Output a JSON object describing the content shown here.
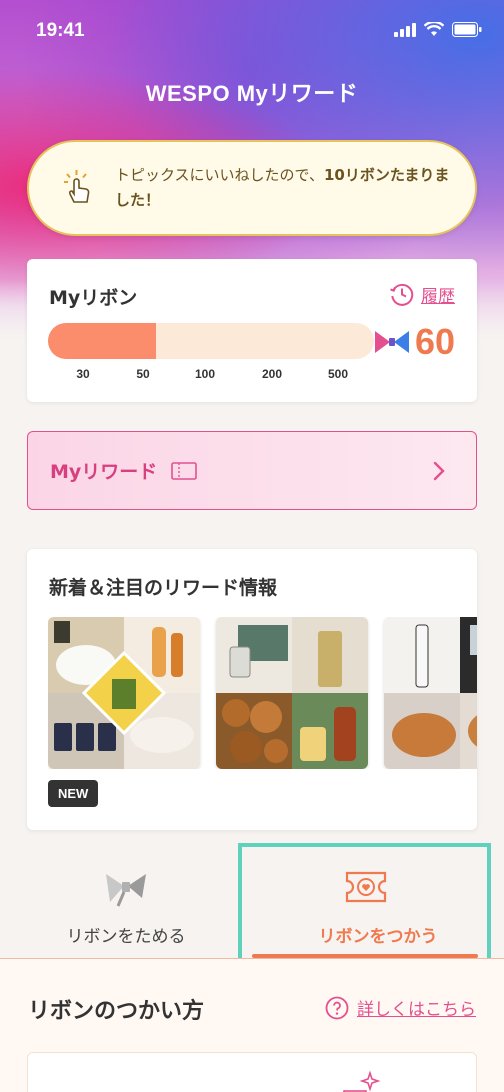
{
  "status": {
    "time": "19:41"
  },
  "header": {
    "title": "WESPO Myリワード"
  },
  "toast": {
    "message_prefix": "トピックスにいいねしたので、",
    "message_bold": "10リボンたまりました！"
  },
  "ribbon": {
    "title": "Myリボン",
    "history_label": "履歴",
    "count": "60",
    "progress_fraction": 0.33,
    "ticks": [
      "30",
      "50",
      "100",
      "200",
      "500"
    ]
  },
  "reward_button": {
    "label": "Myリワード"
  },
  "news": {
    "title": "新着＆注目のリワード情報",
    "new_badge": "NEW"
  },
  "tabs": [
    {
      "label": "リボンをためる"
    },
    {
      "label": "リボンをつかう"
    }
  ],
  "howto": {
    "title": "リボンのつかい方",
    "detail_link": "詳しくはこちら"
  },
  "colors": {
    "accent_pink": "#e4508f",
    "accent_orange": "#f07a50",
    "highlight_teal": "#5fd1bd"
  }
}
